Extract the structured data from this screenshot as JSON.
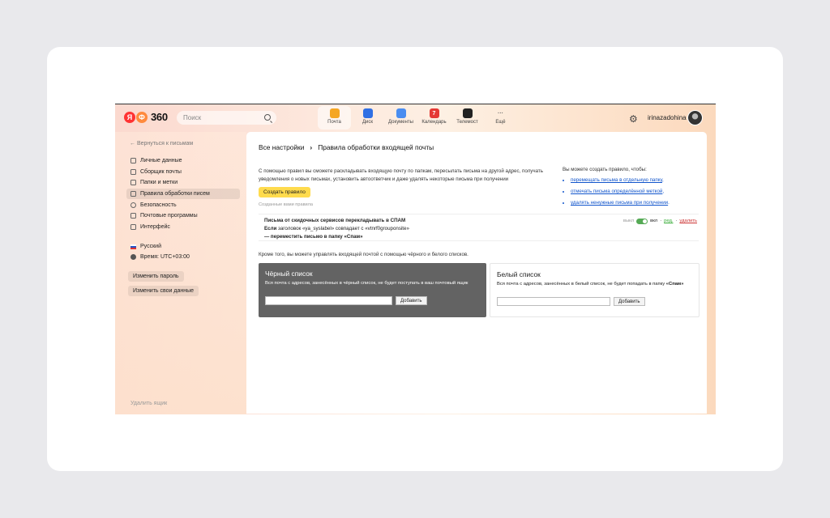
{
  "header": {
    "logo_badge_1": "Я",
    "logo_badge_2": "Ф",
    "logo_text": "360",
    "search_placeholder": "Поиск",
    "apps": [
      {
        "label": "Почта",
        "color": "#f5a623",
        "active": true
      },
      {
        "label": "Диск",
        "color": "#2f6fe4"
      },
      {
        "label": "Документы",
        "color": "#4a8df0"
      },
      {
        "label": "Календарь",
        "color": "#e53935",
        "icon_text": "7"
      },
      {
        "label": "Телемост",
        "color": "#222"
      },
      {
        "label": "Ещё",
        "color": "transparent",
        "icon_text": "···"
      }
    ],
    "username": "irinazadohina"
  },
  "sidebar": {
    "back": "Вернуться к письмам",
    "items": [
      {
        "label": "Личные данные"
      },
      {
        "label": "Сборщик почты"
      },
      {
        "label": "Папки и метки"
      },
      {
        "label": "Правила обработки писем",
        "active": true
      },
      {
        "label": "Безопасность"
      },
      {
        "label": "Почтовые программы"
      },
      {
        "label": "Интерфейс"
      }
    ],
    "language": "Русский",
    "timezone": "Время: UTC+03:00",
    "change_password": "Изменить пароль",
    "change_data": "Изменить свои данные",
    "delete_box": "Удалить ящик"
  },
  "main": {
    "breadcrumb_root": "Все настройки",
    "breadcrumb_sep": "›",
    "breadcrumb_current": "Правила обработки входящей почты",
    "intro": "С помощью правил вы сможете раскладывать входящую почту по папкам, пересылать письма на другой адрес, получать уведомления о новых письмах, установить автоответчик и даже удалять некоторые письма при получении",
    "create_button": "Создать правило",
    "created_by_you": "Созданные вами правила",
    "right_intro": "Вы можете создать правило, чтобы:",
    "right_links": [
      "перемещать письма в отдельную папку",
      "отмечать письма определённой меткой",
      "удалять ненужные письма при получении"
    ],
    "rule": {
      "title": "Письма от скидочных сервисов перекладывать в СПАМ",
      "cond_prefix": "Если",
      "cond_text": " заголовок «ya_syslabel» совпадает с «vtnrf0grouponsite»",
      "action": "— переместить письмо в папку «Спам»",
      "off": "выкл",
      "on": "вкл",
      "edit": "ред.",
      "delete": "удалить"
    },
    "bw_intro": "Кроме того, вы можете управлять входящей почтой с помощью чёрного и белого списков.",
    "blacklist": {
      "title": "Чёрный список",
      "desc": "Вся почта с адресов, занесённых в чёрный список, не будет поступать в ваш почтовый ящик",
      "add": "Добавить"
    },
    "whitelist": {
      "title": "Белый список",
      "desc": "Вся почта с адресов, занесённых в белый список, не будет попадать в папку",
      "desc_bold": "«Спам»",
      "add": "Добавить"
    }
  }
}
